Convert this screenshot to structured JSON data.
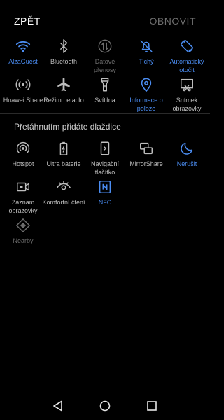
{
  "header": {
    "back_label": "ZPĚT",
    "reset_label": "OBNOVIT"
  },
  "active_tiles": [
    {
      "label": "AlzaGuest",
      "icon": "wifi-icon",
      "state": "on"
    },
    {
      "label": "Bluetooth",
      "icon": "bluetooth-icon",
      "state": "off"
    },
    {
      "label": "Datové přenosy",
      "icon": "mobile-data-icon",
      "state": "disabled"
    },
    {
      "label": "Tichý",
      "icon": "silent-bell-icon",
      "state": "on"
    },
    {
      "label": "Automatický otočit",
      "icon": "auto-rotate-icon",
      "state": "on"
    },
    {
      "label": "Huawei Share",
      "icon": "huawei-share-icon",
      "state": "off"
    },
    {
      "label": "Režim Letadlo",
      "icon": "airplane-icon",
      "state": "off"
    },
    {
      "label": "Svítilna",
      "icon": "flashlight-icon",
      "state": "off"
    },
    {
      "label": "Informace o poloze",
      "icon": "location-icon",
      "state": "on"
    },
    {
      "label": "Snímek obrazovky",
      "icon": "screenshot-icon",
      "state": "off"
    }
  ],
  "section_title": "Přetáhnutím přidáte dlaždice",
  "available_tiles": [
    {
      "label": "Hotspot",
      "icon": "hotspot-icon",
      "state": "off"
    },
    {
      "label": "Ultra baterie",
      "icon": "ultra-battery-icon",
      "state": "off"
    },
    {
      "label": "Navigační tlačítko",
      "icon": "navigation-button-icon",
      "state": "off"
    },
    {
      "label": "MirrorShare",
      "icon": "mirror-share-icon",
      "state": "off"
    },
    {
      "label": "Nerušit",
      "icon": "moon-icon",
      "state": "on"
    },
    {
      "label": "Záznam obrazovky",
      "icon": "screen-record-icon",
      "state": "off"
    },
    {
      "label": "Komfortní čtení",
      "icon": "eye-icon",
      "state": "off"
    },
    {
      "label": "NFC",
      "icon": "nfc-icon",
      "state": "on"
    },
    {
      "label": "Nearby",
      "icon": "nearby-icon",
      "state": "disabled"
    }
  ],
  "navbar": {
    "icons": [
      "back-triangle-icon",
      "home-circle-icon",
      "recents-square-icon"
    ]
  },
  "colors": {
    "active": "#4b8df2",
    "inactive": "#bdbdbd",
    "disabled": "#6e6e6e",
    "background": "#000000"
  }
}
